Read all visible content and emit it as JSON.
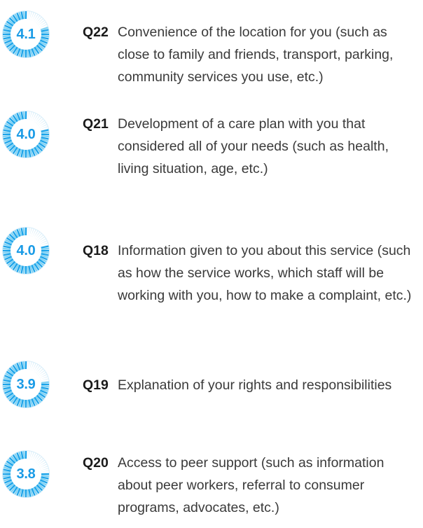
{
  "colors": {
    "accent": "#1aa3ea",
    "accent_light": "#7fd2f4",
    "ring_bg": "#d9eef9",
    "qid_text": "#1a1a1a",
    "body_text": "#3a3a3a"
  },
  "scale_max": 5,
  "items": [
    {
      "score": "4.1",
      "score_value": 4.1,
      "qid": "Q22",
      "text": "Convenience of the location for you (such as close to family and friends, transport, parking, community services you use, etc.)"
    },
    {
      "score": "4.0",
      "score_value": 4.0,
      "qid": "Q21",
      "text": "Development of a care plan with you that considered all of your needs (such as health, living situation, age, etc.)"
    },
    {
      "score": "4.0",
      "score_value": 4.0,
      "qid": "Q18",
      "text": "Information given to you about this service (such as how the service works, which staff will be working with you, how to make a complaint, etc.)"
    },
    {
      "score": "3.9",
      "score_value": 3.9,
      "qid": "Q19",
      "text": "Explanation of your rights and responsibilities"
    },
    {
      "score": "3.8",
      "score_value": 3.8,
      "qid": "Q20",
      "text": "Access to peer support (such as information about peer workers, referral to consumer programs, advocates, etc.)"
    }
  ]
}
